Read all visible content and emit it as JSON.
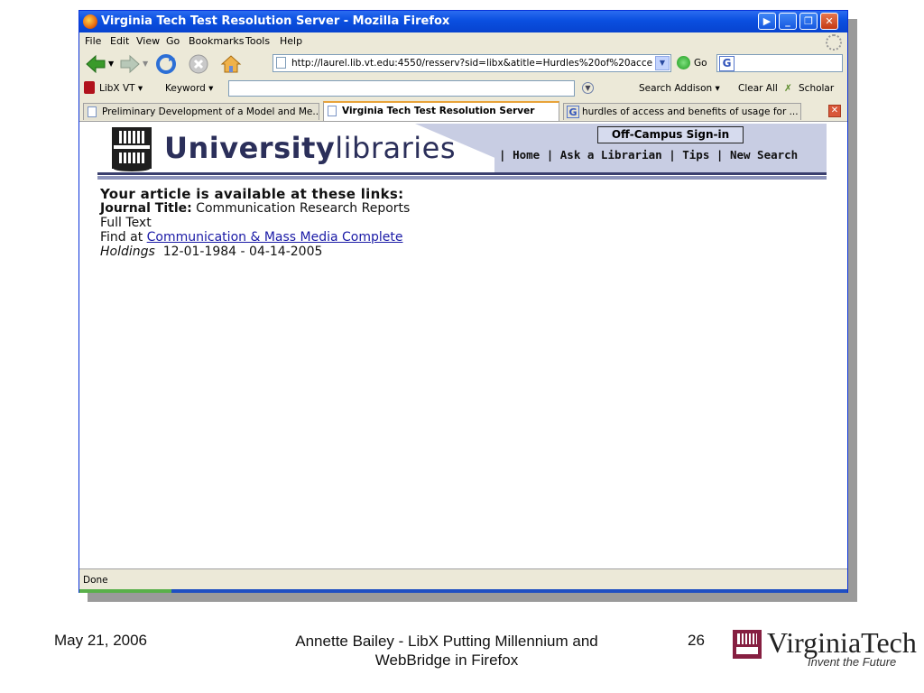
{
  "window": {
    "title": "Virginia Tech Test Resolution Server - Mozilla Firefox",
    "btn_minimize": "_",
    "btn_maximize": "❐",
    "btn_close": "✕"
  },
  "menu": {
    "items": [
      "File",
      "Edit",
      "View",
      "Go",
      "Bookmarks",
      "Tools",
      "Help"
    ]
  },
  "navbar": {
    "url": "http://laurel.lib.vt.edu:4550/resserv?sid=libx&atitle=Hurdles%20of%20acce",
    "go_label": "Go",
    "search_engine_icon": "G"
  },
  "libx": {
    "menu_label": "LibX VT ▾",
    "type_label": "Keyword ▾",
    "search_label": "Search Addison ▾",
    "clear_label": "Clear All",
    "scholar_label": "Scholar"
  },
  "tabs": [
    {
      "label": "Preliminary Development of a Model and Me..."
    },
    {
      "label": "Virginia Tech Test Resolution Server"
    },
    {
      "label": "hurdles of access and benefits of usage for ..."
    }
  ],
  "banner": {
    "university": "University",
    "libraries": "libraries",
    "offcampus": "Off-Campus Sign-in",
    "nav": [
      "Home",
      "Ask a Librarian",
      "Tips",
      "New Search"
    ],
    "sep": "|"
  },
  "article": {
    "heading": "Your article is available at these links:",
    "journal_label": "Journal Title:",
    "journal_value": "Communication Research Reports",
    "fulltext": "Full Text",
    "find_at": "Find at",
    "database_link": "Communication & Mass Media Complete",
    "holdings_label": "Holdings",
    "holdings_value": "12-01-1984 - 04-14-2005"
  },
  "status": {
    "text": "Done"
  },
  "footer": {
    "date": "May 21, 2006",
    "title_line1": "Annette Bailey - LibX Putting Millennium and",
    "title_line2": "WebBridge in Firefox",
    "page": "26",
    "logo_name": "VirginiaTech",
    "logo_tagline": "Invent the Future"
  },
  "colors": {
    "titlebar": "#0a4fe0",
    "chrome": "#ece9d8",
    "banner": "#c8cde3",
    "link": "#1a1aa6",
    "vt_maroon": "#861f41"
  }
}
